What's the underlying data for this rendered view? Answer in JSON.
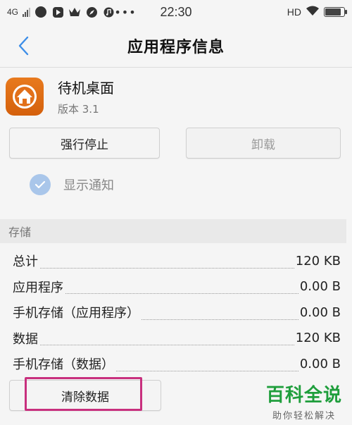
{
  "status_bar": {
    "network": "4G",
    "time": "22:30",
    "hd": "HD",
    "battery_level": 0.85,
    "icons": [
      "signal-icon",
      "app-circle-icon",
      "play-icon",
      "crown-icon",
      "compass-icon",
      "music-icon",
      "more-dots-icon",
      "wifi-icon",
      "battery-icon"
    ]
  },
  "header": {
    "title": "应用程序信息",
    "back_icon": "chevron-left-icon"
  },
  "app": {
    "name": "待机桌面",
    "version": "版本 3.1",
    "icon": "home-icon"
  },
  "actions": {
    "force_stop": "强行停止",
    "uninstall": "卸载"
  },
  "notification": {
    "label": "显示通知",
    "checked": true
  },
  "storage": {
    "section_title": "存储",
    "rows": [
      {
        "label": "总计",
        "value": "120 KB"
      },
      {
        "label": "应用程序",
        "value": "0.00 B"
      },
      {
        "label": "手机存储（应用程序）",
        "value": "0.00 B"
      },
      {
        "label": "数据",
        "value": "120 KB"
      },
      {
        "label": "手机存储（数据）",
        "value": "0.00 B"
      }
    ],
    "clear_data": "清除数据"
  },
  "watermark": {
    "title": "百科全说",
    "subtitle": "助你轻松解决"
  },
  "colors": {
    "accent": "#3d8ee8",
    "highlight": "#c8307e",
    "watermark": "#1f9e3c",
    "app_icon": "#e2701a"
  }
}
